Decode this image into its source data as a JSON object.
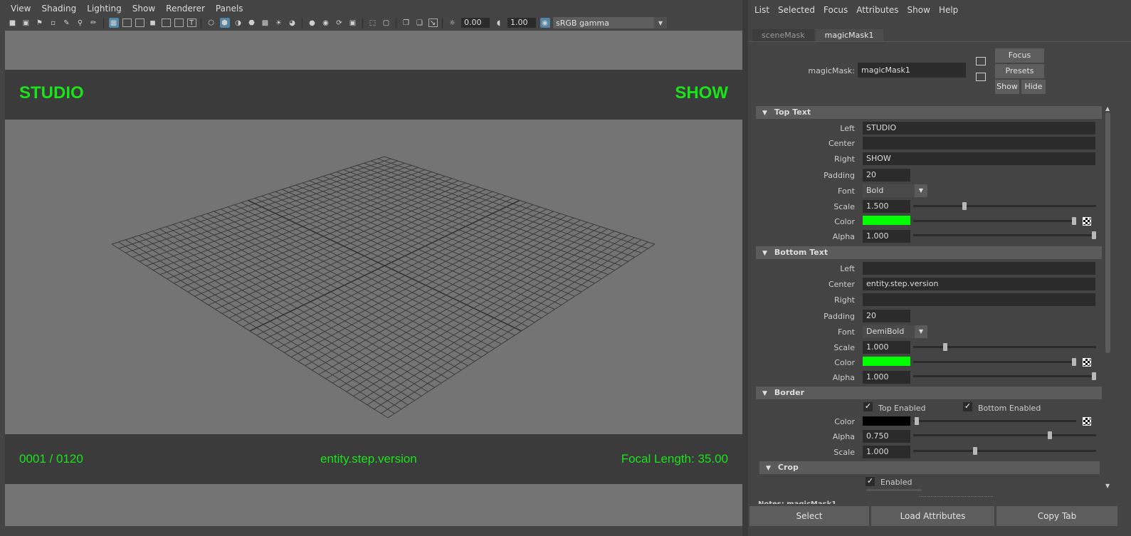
{
  "viewport": {
    "menus": [
      "View",
      "Shading",
      "Lighting",
      "Show",
      "Renderer",
      "Panels"
    ],
    "toolbar": {
      "exposure": "0.00",
      "gamma": "1.00",
      "color_management_label": "sRGB gamma"
    },
    "hud": {
      "top_left": "STUDIO",
      "top_right": "SHOW",
      "bottom_left": "0001 / 0120",
      "bottom_center": "entity.step.version",
      "bottom_right": "Focal Length: 35.00"
    }
  },
  "attribute_editor": {
    "menus": [
      "List",
      "Selected",
      "Focus",
      "Attributes",
      "Show",
      "Help"
    ],
    "tabs": [
      "sceneMask",
      "magicMask1"
    ],
    "node": {
      "label": "magicMask:",
      "value": "magicMask1"
    },
    "buttons": {
      "focus": "Focus",
      "presets": "Presets",
      "show": "Show",
      "hide": "Hide"
    },
    "top_text": {
      "title": "Top Text",
      "left_label": "Left",
      "left": "STUDIO",
      "center_label": "Center",
      "center": "",
      "right_label": "Right",
      "right": "SHOW",
      "padding_label": "Padding",
      "padding": "20",
      "font_label": "Font",
      "font": "Bold",
      "scale_label": "Scale",
      "scale": "1.500",
      "color_label": "Color",
      "color": "#00ff00",
      "alpha_label": "Alpha",
      "alpha": "1.000"
    },
    "bottom_text": {
      "title": "Bottom Text",
      "left_label": "Left",
      "left": "",
      "center_label": "Center",
      "center": "entity.step.version",
      "right_label": "Right",
      "right": "",
      "padding_label": "Padding",
      "padding": "20",
      "font_label": "Font",
      "font": "DemiBold",
      "scale_label": "Scale",
      "scale": "1.000",
      "color_label": "Color",
      "color": "#00ff00",
      "alpha_label": "Alpha",
      "alpha": "1.000"
    },
    "border": {
      "title": "Border",
      "top_enabled_label": "Top Enabled",
      "bottom_enabled_label": "Bottom Enabled",
      "color_label": "Color",
      "color": "#000000",
      "alpha_label": "Alpha",
      "alpha": "0.750",
      "scale_label": "Scale",
      "scale": "1.000"
    },
    "crop": {
      "title": "Crop",
      "enabled_label": "Enabled"
    },
    "notes_label": "Notes: magicMask1",
    "bottom_buttons": {
      "select": "Select",
      "load_attributes": "Load Attributes",
      "copy_tab": "Copy Tab"
    }
  }
}
